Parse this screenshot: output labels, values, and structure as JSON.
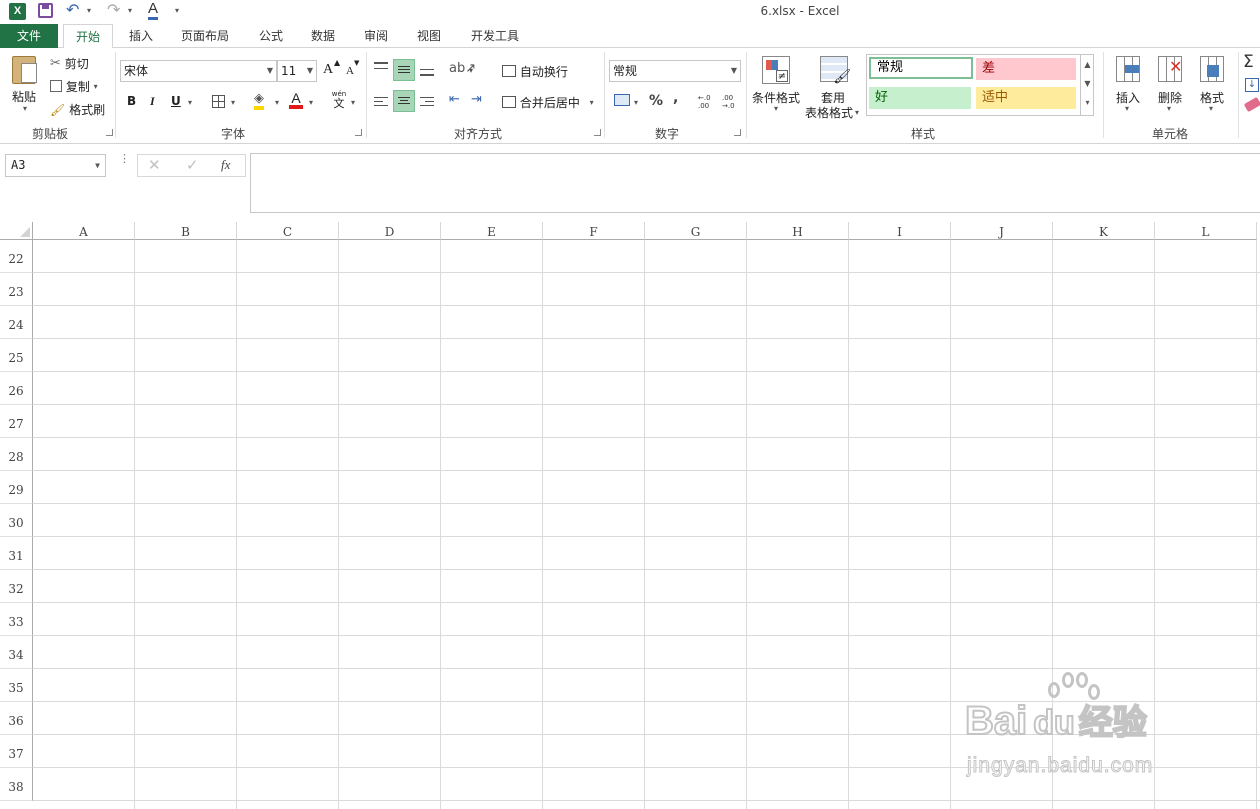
{
  "window": {
    "title": "6.xlsx - Excel"
  },
  "quick_access": {
    "icons": [
      "excel-logo-icon",
      "save-icon",
      "undo-icon",
      "redo-icon",
      "font-color-a-icon",
      "customize-icon"
    ]
  },
  "tabs": [
    {
      "label": "文件"
    },
    {
      "label": "开始"
    },
    {
      "label": "插入"
    },
    {
      "label": "页面布局"
    },
    {
      "label": "公式"
    },
    {
      "label": "数据"
    },
    {
      "label": "审阅"
    },
    {
      "label": "视图"
    },
    {
      "label": "开发工具"
    }
  ],
  "ribbon": {
    "clipboard": {
      "label": "剪贴板",
      "paste": "粘贴",
      "cut": "剪切",
      "copy": "复制",
      "format_painter": "格式刷"
    },
    "font": {
      "label": "字体",
      "font_name": "宋体",
      "font_size": "11",
      "grow": "A",
      "shrink": "A",
      "bold": "B",
      "italic": "I",
      "underline": "U",
      "font_color_letter": "A",
      "wen": "wén",
      "wen_char": "文",
      "fill_color": "#ffd700",
      "font_color": "#e0191b"
    },
    "alignment": {
      "label": "对齐方式",
      "wrap_text": "自动换行",
      "merge_center": "合并后居中"
    },
    "number": {
      "label": "数字",
      "format": "常规",
      "percent": "%",
      "comma": ",",
      "inc_decimal": "←.0 .00",
      "dec_decimal": ".00 →.0"
    },
    "styles": {
      "label": "样式",
      "conditional_format": "条件格式",
      "table_format_line1": "套用",
      "table_format_line2": "表格格式",
      "cells": [
        {
          "label": "常规",
          "bg": "#ffffff",
          "fg": "#000000"
        },
        {
          "label": "差",
          "bg": "#ffc7ce",
          "fg": "#9c0006"
        },
        {
          "label": "好",
          "bg": "#c6efce",
          "fg": "#006100"
        },
        {
          "label": "适中",
          "bg": "#ffeb9c",
          "fg": "#9c5700"
        }
      ]
    },
    "cells_group": {
      "label": "单元格",
      "insert": "插入",
      "delete": "删除",
      "format": "格式"
    }
  },
  "formula_bar": {
    "name_box": "A3",
    "fx": "fx",
    "value": ""
  },
  "sheet": {
    "columns": [
      "A",
      "B",
      "C",
      "D",
      "E",
      "F",
      "G",
      "H",
      "I",
      "J",
      "K",
      "L"
    ],
    "rows": [
      "22",
      "23",
      "24",
      "25",
      "26",
      "27",
      "28",
      "29",
      "30",
      "31",
      "32",
      "33",
      "34",
      "35",
      "36",
      "37",
      "38"
    ]
  },
  "watermark": {
    "brand_a": "Bai",
    "brand_b": "du",
    "brand_c": "经验",
    "url": "jingyan.baidu.com"
  },
  "colors": {
    "excel_green": "#217346",
    "selected_align": "#a8d5b8"
  }
}
